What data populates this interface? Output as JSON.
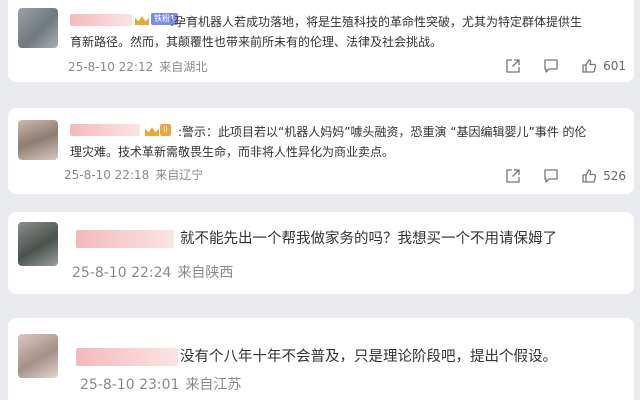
{
  "comments": [
    {
      "badge_tag": "铁粉1",
      "text": ":孕育机器人若成功落地，将是生殖科技的革命性突破，尤其为特定群体提供生育新路径。然而，其颠覆性也带来前所未有的伦理、法律及社会挑战。",
      "text_line1": ":孕育机器人若成功落地，将是生殖科技的革命性突破，尤其为特定群体提供生",
      "text_line2": "育新路径。然而，其颠覆性也带来前所未有的伦理、法律及社会挑战。",
      "time": "25-8-10 22:12",
      "location": "来自湖北",
      "like_count": "601"
    },
    {
      "badge_tag": "II",
      "text_line1": ":警示：此项目若以“机器人妈妈”噱头融资，恐重演 “基因编辑婴儿”事件 的伦",
      "text_line2": "理灾难。技术革新需敬畏生命，而非将人性异化为商业卖点。",
      "time": "25-8-10 22:18",
      "location": "来自辽宁",
      "like_count": "526"
    },
    {
      "text": "就不能先出一个帮我做家务的吗？我想买一个不用请保姆了",
      "time": "25-8-10 22:24",
      "location": "来自陕西"
    },
    {
      "text": "没有个八年十年不会普及，只是理论阶段吧，提出个假设。",
      "time": "25-8-10 23:01",
      "location": "来自江苏"
    }
  ],
  "icons": {
    "share": "share-icon",
    "comment": "comment-icon",
    "like": "thumbs-up-icon"
  },
  "colors": {
    "background": "#e9eaed",
    "card": "#ffffff",
    "meta_text": "#8a8a8a",
    "redacted_name": "#f4b9b9"
  }
}
